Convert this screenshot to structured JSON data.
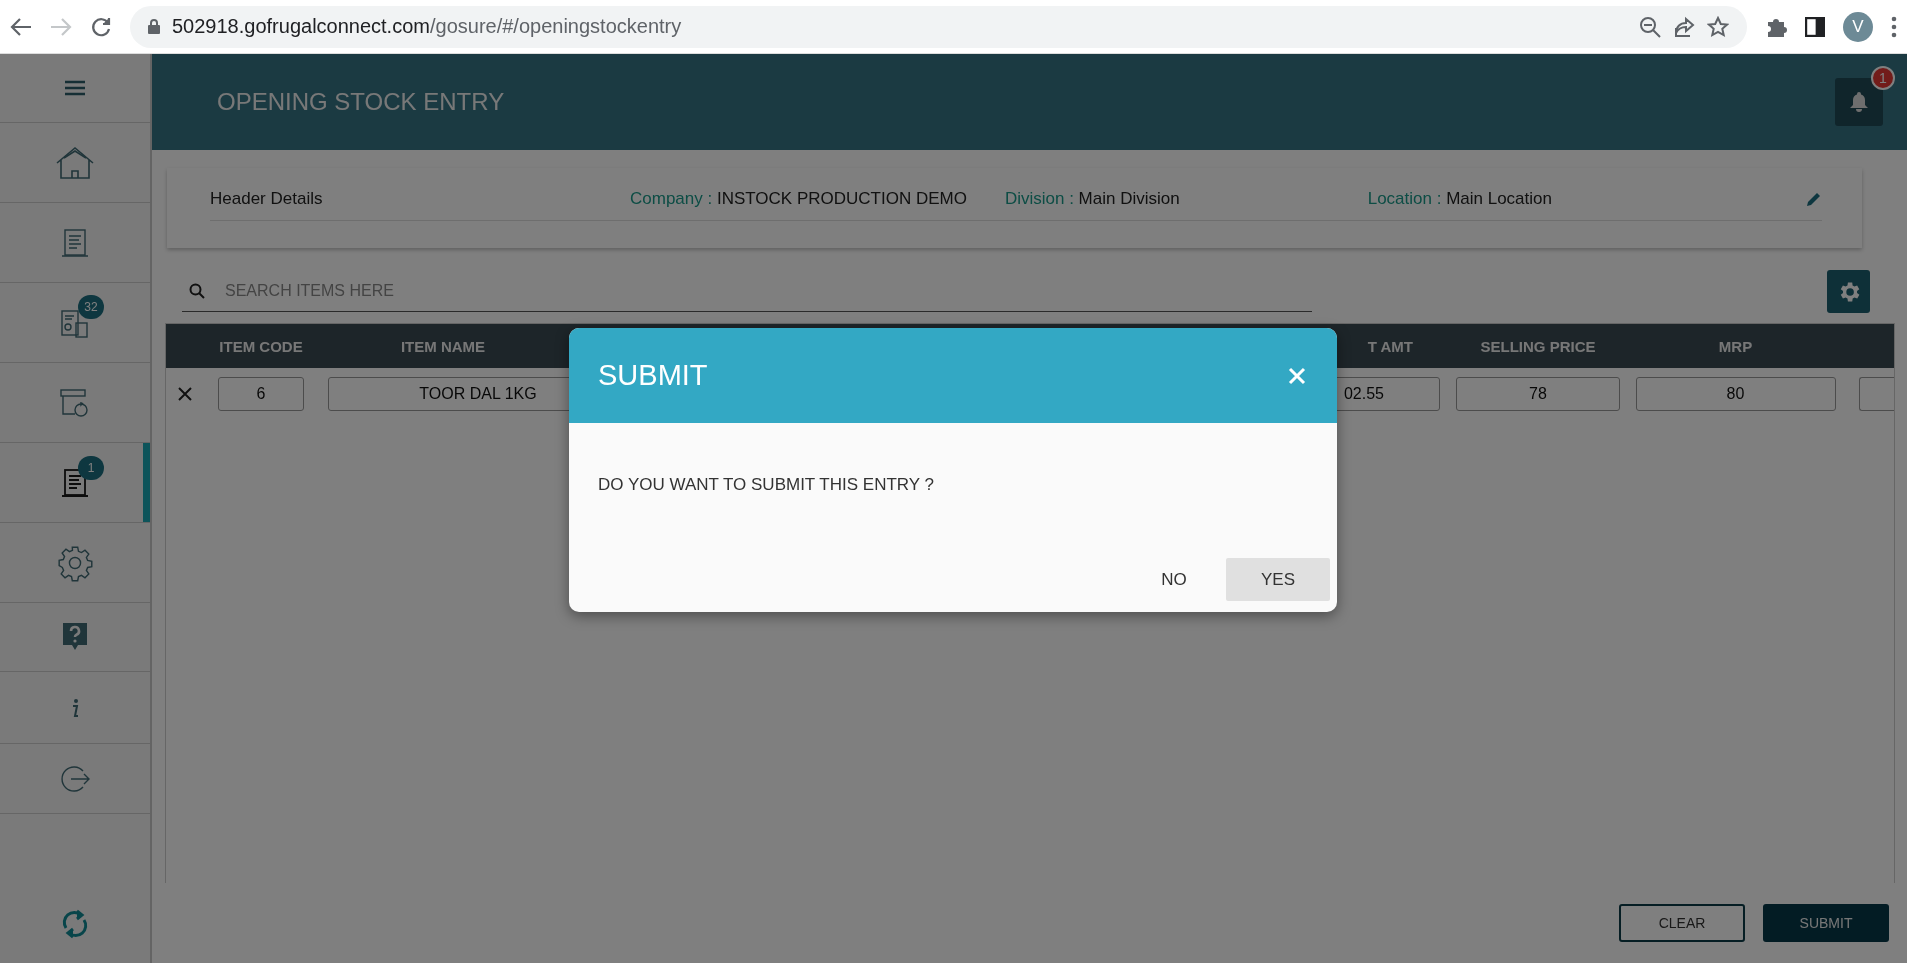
{
  "browser": {
    "url_host": "502918.gofrugalconnect.com",
    "url_path": "/gosure/#/openingstockentry",
    "forward_disabled": true,
    "profile_initial": "V"
  },
  "sidebar": {
    "items": [
      {
        "kind": "menu",
        "selected": false
      },
      {
        "kind": "home",
        "selected": false
      },
      {
        "kind": "document",
        "selected": false
      },
      {
        "kind": "report",
        "selected": false,
        "badge": "32"
      },
      {
        "kind": "box",
        "selected": false
      },
      {
        "kind": "document",
        "selected": true,
        "badge": "1"
      },
      {
        "kind": "settings",
        "selected": false
      },
      {
        "kind": "help",
        "selected": false
      },
      {
        "kind": "info",
        "selected": false
      },
      {
        "kind": "logout",
        "selected": false
      },
      {
        "kind": "sync",
        "selected": false
      }
    ]
  },
  "header": {
    "title": "OPENING STOCK ENTRY",
    "notification_count": "1"
  },
  "header_details": {
    "label": "Header Details",
    "fields": [
      {
        "label": "Company :",
        "value": "INSTOCK PRODUCTION DEMO"
      },
      {
        "label": "Division :",
        "value": "Main Division"
      },
      {
        "label": "Location :",
        "value": "Main Location"
      }
    ]
  },
  "search": {
    "placeholder": "SEARCH ITEMS HERE"
  },
  "table": {
    "columns": [
      "ITEM CODE",
      "ITEM NAME",
      "T AMT",
      "SELLING PRICE",
      "MRP"
    ],
    "rows": [
      {
        "cells": [
          "6",
          "TOOR DAL 1KG",
          "02.55",
          "78",
          "80"
        ]
      }
    ]
  },
  "dialog": {
    "title": "SUBMIT",
    "message": "DO YOU WANT TO SUBMIT THIS ENTRY ?",
    "buttons": [
      {
        "label": "NO",
        "focused": false
      },
      {
        "label": "YES",
        "focused": true
      }
    ]
  },
  "footer_buttons": [
    {
      "label": "CLEAR",
      "kind": "outline"
    },
    {
      "label": "SUBMIT",
      "kind": "filled"
    }
  ]
}
